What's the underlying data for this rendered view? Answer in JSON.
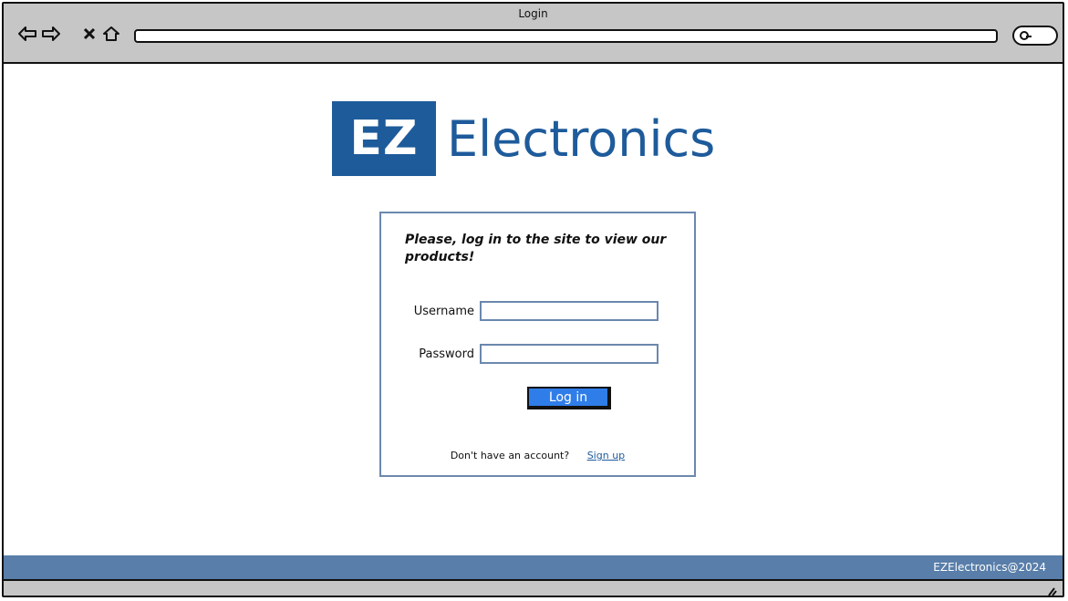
{
  "window": {
    "title": "Login"
  },
  "browser": {
    "icons": [
      "back-arrow-icon",
      "forward-arrow-icon",
      "close-icon",
      "home-icon",
      "search-icon",
      "resize-grip-icon"
    ],
    "url": ""
  },
  "logo": {
    "badge": "EZ",
    "name": "Electronics",
    "brand_color": "#1e5b9b"
  },
  "login": {
    "prompt": "Please, log in to the site to view our products!",
    "username_label": "Username",
    "password_label": "Password",
    "button_label": "Log in",
    "no_account_text": "Don't have an account?",
    "signup_link": "Sign up",
    "accent_color": "#2f7de8"
  },
  "footer": {
    "text": "EZElectronics@2024",
    "color": "#587ea9"
  }
}
